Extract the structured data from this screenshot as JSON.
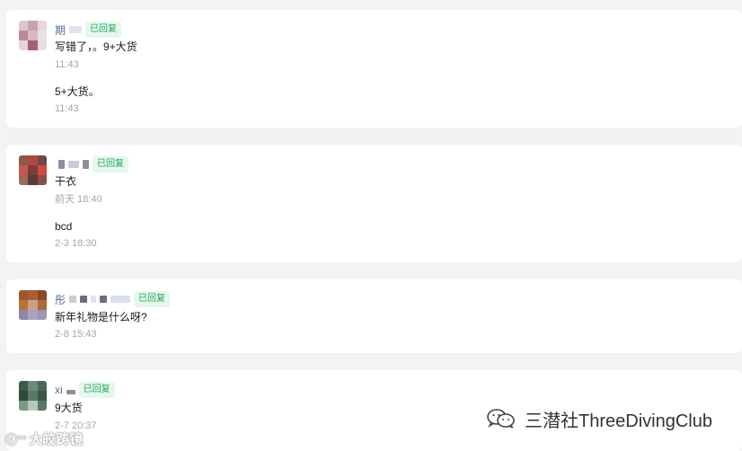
{
  "comments": [
    {
      "name": "期",
      "badge": "已回复",
      "messages": [
        {
          "text": "写错了，。9+大货",
          "time": "11:43"
        },
        {
          "text": "5+大货。",
          "time": "11:43"
        }
      ]
    },
    {
      "name": "",
      "badge": "已回复",
      "messages": [
        {
          "text": "干衣",
          "time": "前天 18:40"
        },
        {
          "text": "bcd",
          "time": "2-3 18:30"
        }
      ]
    },
    {
      "name": "彤",
      "badge": "已回复",
      "messages": [
        {
          "text": "新年礼物是什么呀?",
          "time": "2-8 15:43"
        }
      ]
    },
    {
      "name": "xi",
      "badge": "已回复",
      "messages": [
        {
          "text": "9大货",
          "time": "2-7 20:37"
        }
      ]
    }
  ],
  "watermarks": {
    "left": "大皎踌镜",
    "left_logo": "ⓒ°°",
    "right": "三潜社ThreeDivingClub"
  },
  "colors": {
    "background": "#f2f3f5",
    "card": "#ffffff",
    "name": "#576b95",
    "badge_text": "#23a85f",
    "badge_bg": "#e6f7ec",
    "time": "#a6a6a6"
  },
  "icons": {
    "avatar": "blurred-avatar",
    "wechat": "wechat-logo-icon"
  }
}
